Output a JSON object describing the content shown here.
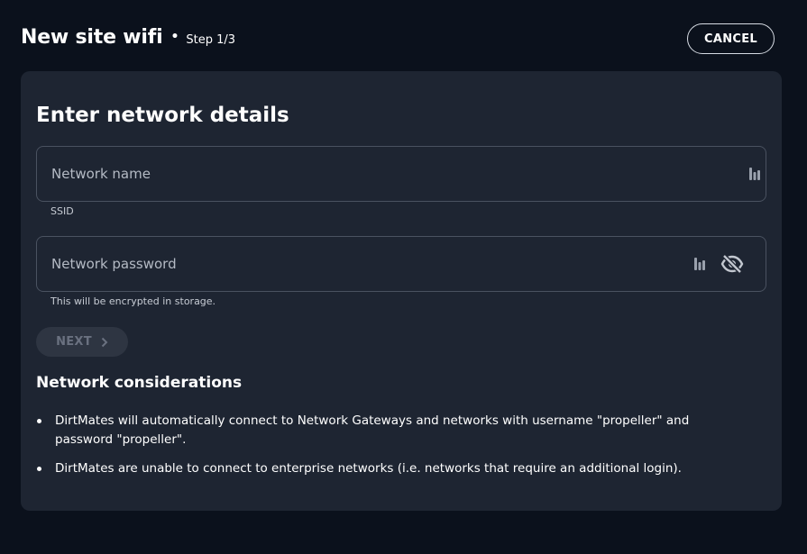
{
  "header": {
    "title": "New site wifi",
    "step": "Step 1/3",
    "cancel_label": "CANCEL"
  },
  "form": {
    "heading": "Enter network details",
    "network_name": {
      "placeholder": "Network name",
      "value": "",
      "helper": "SSID"
    },
    "network_password": {
      "placeholder": "Network password",
      "value": "",
      "helper": "This will be encrypted in storage.",
      "visibility_icon": "eye-off-icon"
    },
    "next_label": "NEXT",
    "next_enabled": false
  },
  "considerations": {
    "heading": "Network considerations",
    "items": [
      "DirtMates will automatically connect to Network Gateways and networks with username \"propeller\" and password \"propeller\".",
      "DirtMates are unable to connect to enterprise networks (i.e. networks that require an additional login)."
    ]
  },
  "colors": {
    "background": "#0b111c",
    "card": "#1e2532",
    "field_border": "#4a5260",
    "disabled_button": "#2e3542",
    "disabled_text": "#6a7180"
  }
}
